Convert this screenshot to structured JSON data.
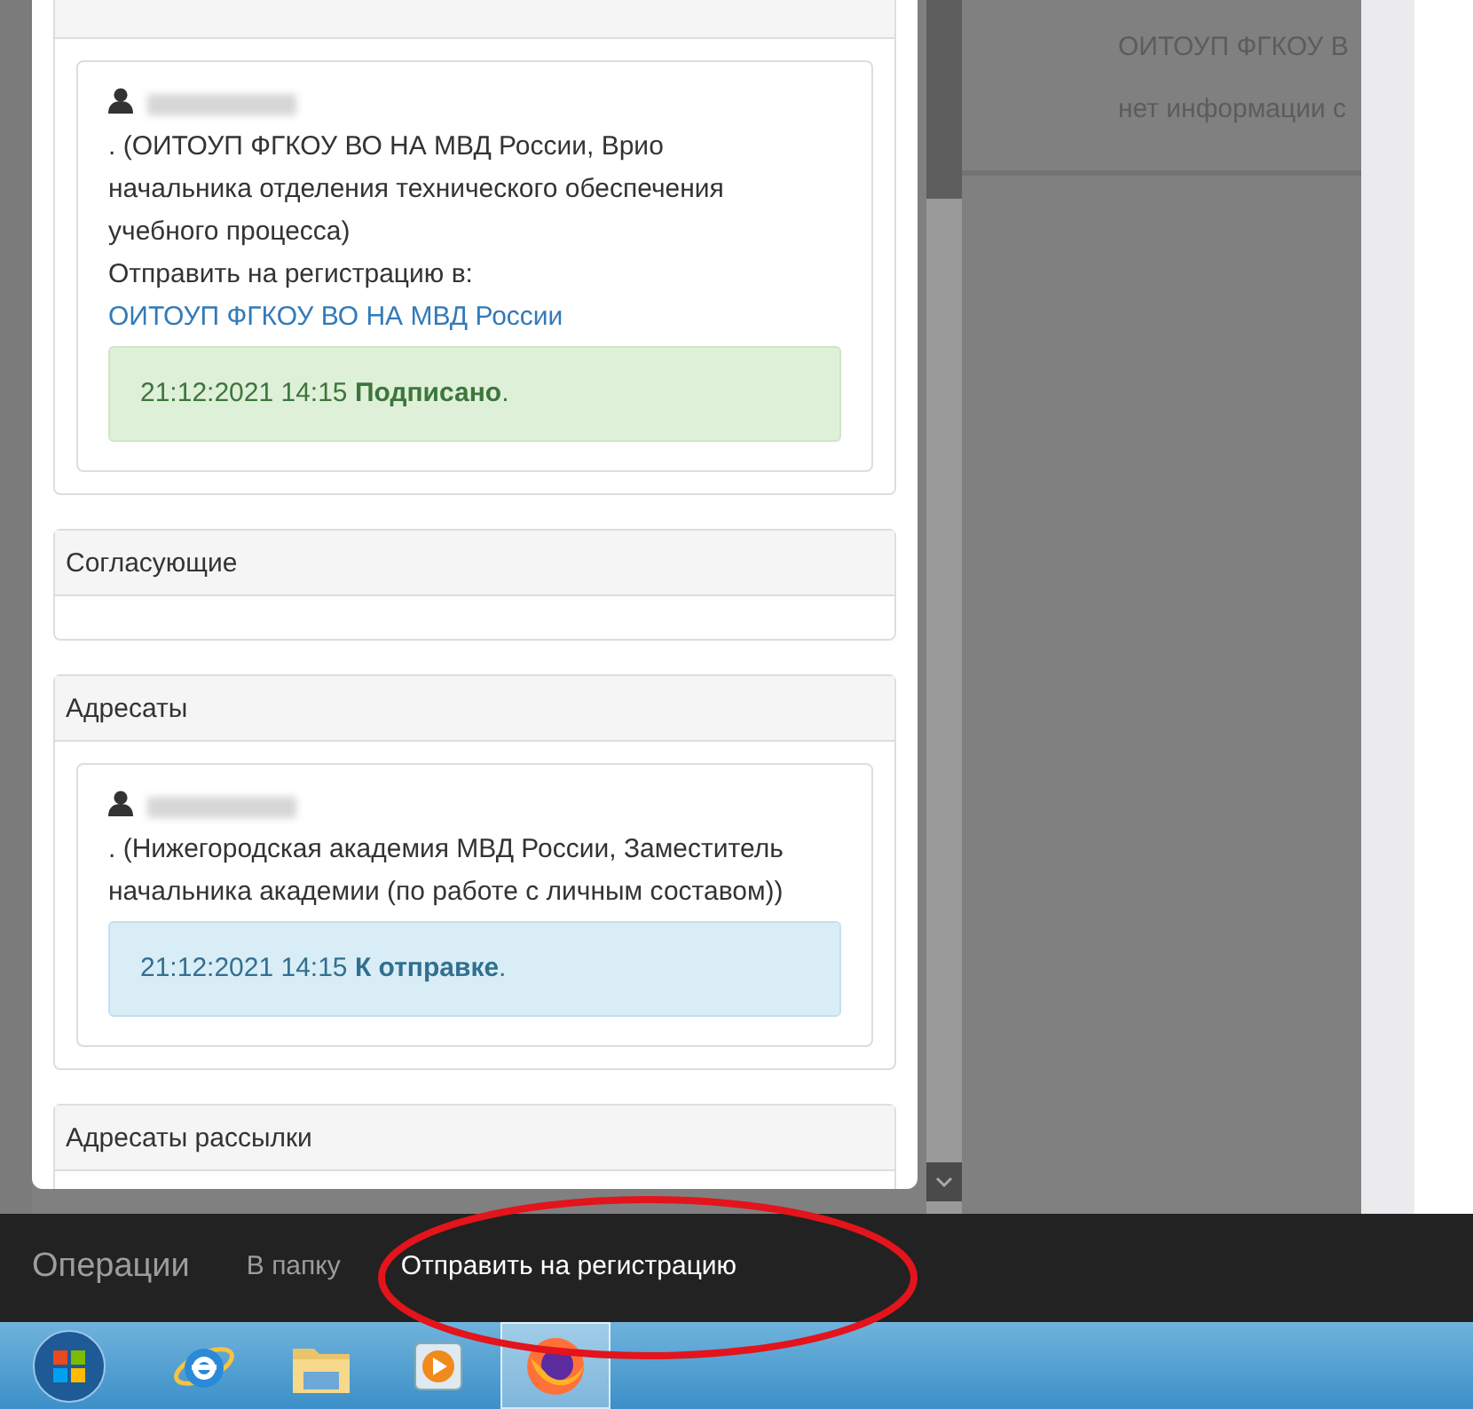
{
  "panels": [
    {
      "entries": [
        {
          "text": ". (ОИТОУП ФГКОУ ВО НА МВД России, Врио начальника отделения технического обеспечения учебного процесса)",
          "route_label": "Отправить на регистрацию в:",
          "route_link": "ОИТОУП ФГКОУ ВО НА МВД России",
          "status": {
            "kind": "success",
            "text": "21:12:2021 14:15 **Подписано**."
          }
        }
      ]
    },
    {
      "title": "Согласующие"
    },
    {
      "title": "Адресаты",
      "entries": [
        {
          "text": ". (Нижегородская академия МВД России, Заместитель начальника академии (по работе с личным составом))",
          "status": {
            "kind": "info",
            "text": "21:12:2021 14:15 **К отправке**."
          }
        }
      ]
    },
    {
      "title": "Адресаты рассылки"
    }
  ],
  "background_lines": [
    "ОИТОУП ФГКОУ В",
    "нет информации с"
  ],
  "operations_bar": {
    "title": "Операции",
    "items": [
      {
        "label": "В папку",
        "emphasized": false
      },
      {
        "label": "Отправить на регистрацию",
        "emphasized": true
      }
    ]
  },
  "taskbar": {
    "apps": [
      {
        "kind": "browser-e",
        "selected": false
      },
      {
        "kind": "folder",
        "selected": false
      },
      {
        "kind": "player",
        "selected": false
      },
      {
        "kind": "fox",
        "selected": true
      }
    ]
  }
}
